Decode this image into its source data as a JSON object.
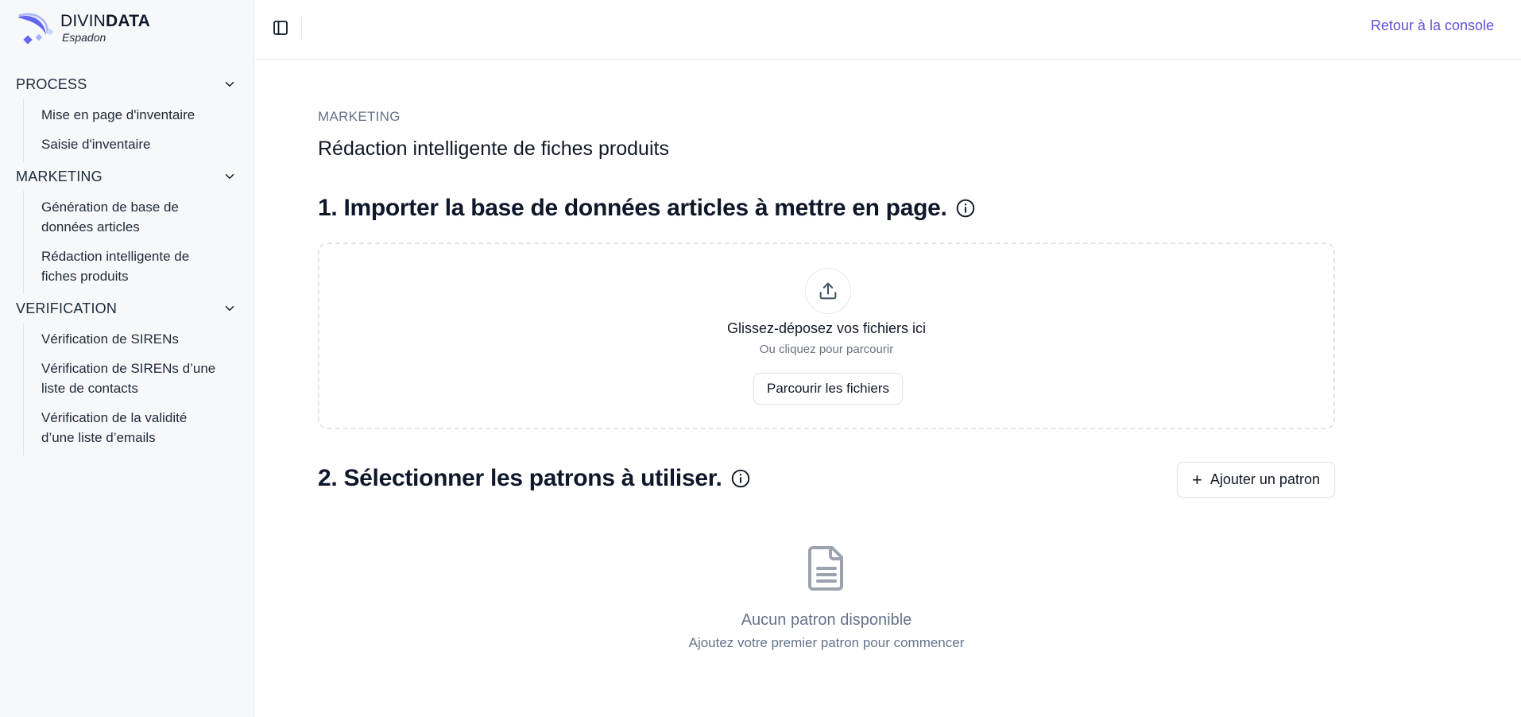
{
  "brand": {
    "name_part1": "DIVIN",
    "name_part2": "DATA",
    "subtitle": "Espadon"
  },
  "header": {
    "console_link": "Retour à la console"
  },
  "sidebar": {
    "sections": [
      {
        "title": "PROCESS",
        "items": [
          "Mise en page d'inventaire",
          "Saisie d'inventaire"
        ]
      },
      {
        "title": "MARKETING",
        "items": [
          "Génération de base de données articles",
          "Rédaction intelligente de fiches produits"
        ]
      },
      {
        "title": "VERIFICATION",
        "items": [
          "Vérification de SIRENs",
          "Vérification de SIRENs d’une liste de contacts",
          "Vérification de la validité d’une liste d’emails"
        ]
      }
    ]
  },
  "main": {
    "eyebrow": "MARKETING",
    "title": "Rédaction intelligente de fiches produits",
    "step1": {
      "title": "1. Importer la base de données articles à mettre en page.",
      "drop_title": "Glissez-déposez vos fichiers ici",
      "drop_sub": "Ou cliquez pour parcourir",
      "browse_label": "Parcourir les fichiers"
    },
    "step2": {
      "title": "2. Sélectionner les patrons à utiliser.",
      "add_label": "Ajouter un patron",
      "empty_title": "Aucun patron disponible",
      "empty_sub": "Ajoutez votre premier patron pour commencer"
    }
  },
  "colors": {
    "accent": "#5b4fe0",
    "logo_primary": "#6366f1",
    "muted": "#64748b"
  },
  "icons": [
    "sidebar-toggle-icon",
    "chevron-down-icon",
    "info-icon",
    "upload-icon",
    "plus-icon",
    "document-icon"
  ]
}
